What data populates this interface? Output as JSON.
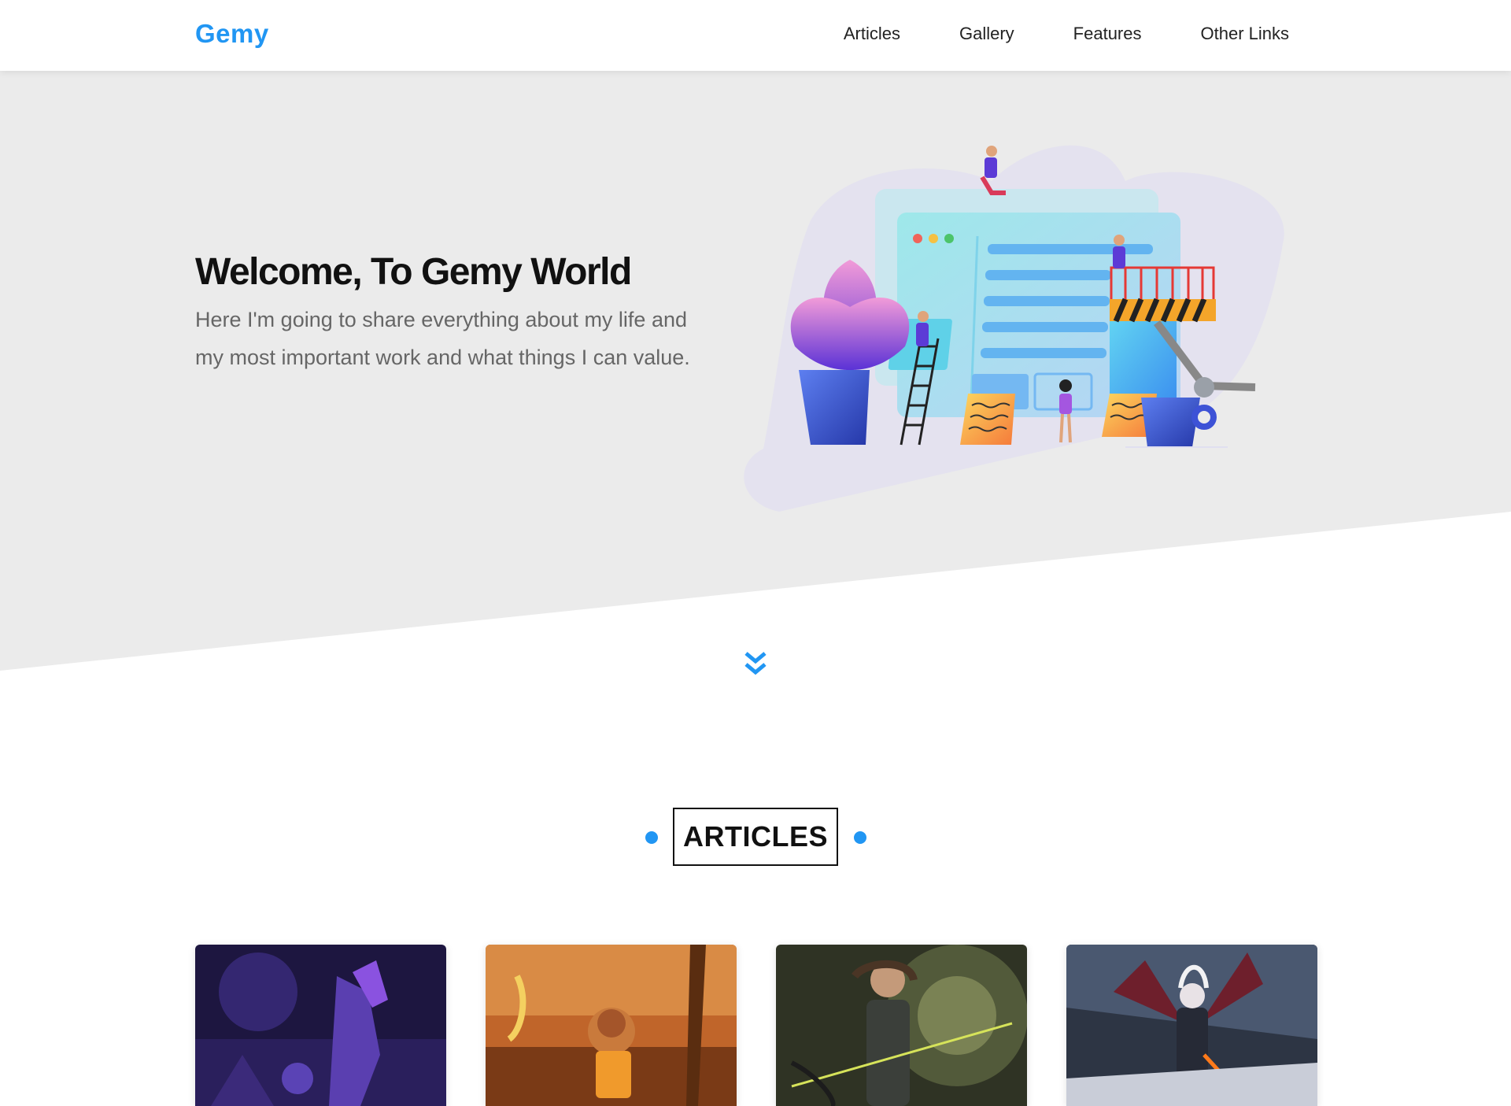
{
  "header": {
    "logo": "Gemy",
    "nav": [
      "Articles",
      "Gallery",
      "Features",
      "Other Links"
    ]
  },
  "landing": {
    "title": "Welcome, To Gemy World",
    "subtitle": "Here I'm going to share everything about my life and my most important work and what things I can value."
  },
  "articles": {
    "heading": "ARTICLES"
  },
  "colors": {
    "accent": "#2196f3",
    "landing_bg": "#ebebeb"
  },
  "icons": [
    "chevron-double-down-icon"
  ]
}
